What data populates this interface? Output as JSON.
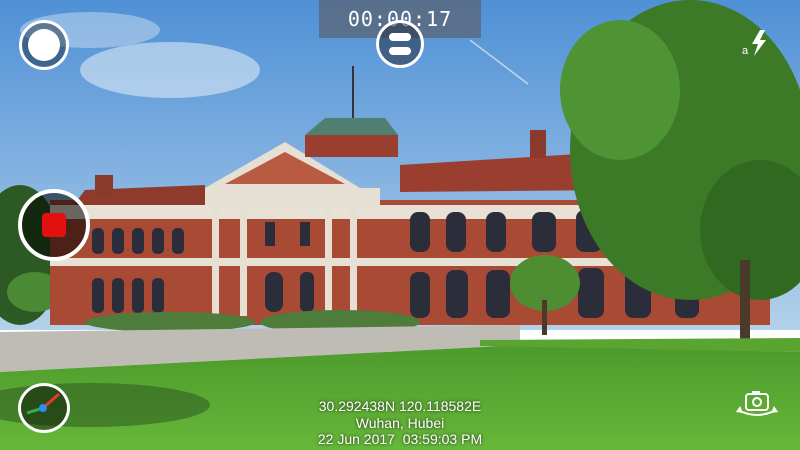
{
  "recording": {
    "elapsed_time": "00:00:17"
  },
  "location_overlay": {
    "coordinates": "30.292438N 120.118582E",
    "place": "Wuhan, Hubei",
    "datetime": "22 Jun 2017  03:59:03 PM"
  },
  "controls": {
    "record_color": "#e31010",
    "icons": [
      "photo-shutter-icon",
      "menu-icon",
      "flash-auto-icon",
      "record-stop-icon",
      "compass-icon",
      "switch-camera-icon"
    ]
  },
  "colors": {
    "sky": "#6fa5dc",
    "brick": "#a84a34",
    "grass": "#5aa532",
    "overlay_text": "#ffffff"
  }
}
